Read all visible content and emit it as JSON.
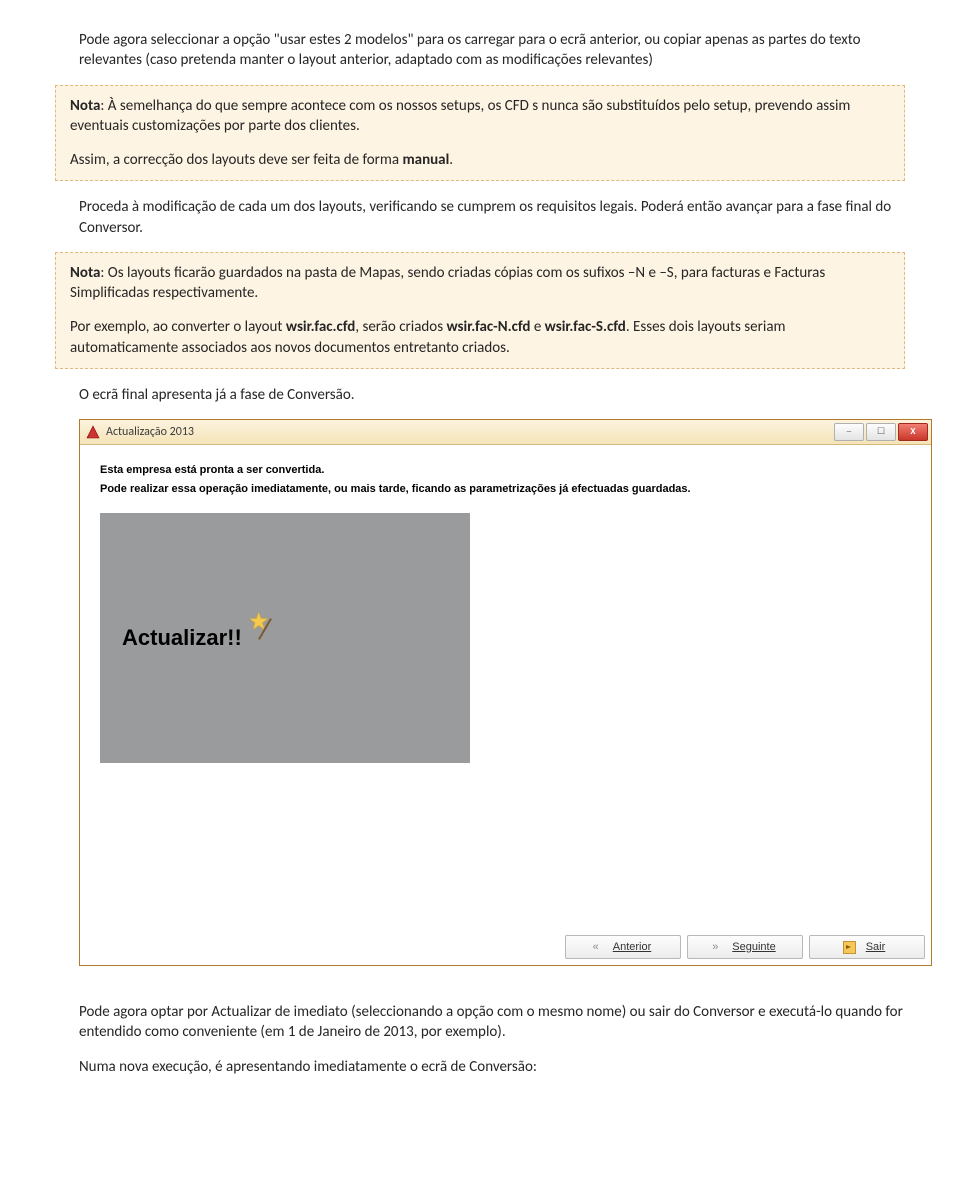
{
  "para1": "Pode agora seleccionar a opção \"usar estes 2 modelos\" para os carregar para o ecrã anterior, ou copiar apenas as partes do texto relevantes (caso pretenda manter o layout anterior, adaptado com as modificações relevantes)",
  "note1": {
    "nota_label": "Nota",
    "line1_rest": ": À semelhança do que sempre acontece com os nossos setups, os CFD s nunca são substituídos pelo setup, prevendo assim eventuais customizações por parte dos clientes.",
    "line2_pre": "Assim, a correcção dos layouts deve ser feita de forma ",
    "line2_bold": "manual",
    "line2_post": "."
  },
  "para2": "Proceda à modificação de cada um dos layouts, verificando se cumprem os requisitos legais. Poderá então avançar para a fase final do Conversor.",
  "note2": {
    "nota_label": "Nota",
    "line1_rest": ": Os layouts ficarão guardados na pasta de Mapas, sendo criadas cópias com os sufixos –N e –S, para facturas e Facturas Simplificadas respectivamente.",
    "line2_pre": "Por exemplo, ao converter o layout ",
    "f1": "wsir.fac.cfd",
    "line2_mid": ", serão criados ",
    "f2": "wsir.fac-N.cfd",
    "line2_and": " e ",
    "f3": "wsir.fac-S.cfd",
    "line2_post": ". Esses dois layouts seriam automaticamente associados aos novos documentos entretanto criados."
  },
  "para3": "O ecrã final apresenta já a fase de Conversão.",
  "dialog": {
    "title": "Actualização 2013",
    "msg1": "Esta empresa está pronta a ser convertida.",
    "msg2": "Pode realizar essa operação imediatamente, ou mais tarde, ficando as parametrizações já efectuadas guardadas.",
    "big_label": "Actualizar!!",
    "btn_prev": "Anterior",
    "btn_next": "Seguinte",
    "btn_exit": "Sair"
  },
  "para4": "Pode agora optar por Actualizar de imediato (seleccionando a opção com o mesmo nome) ou sair do Conversor e executá-lo quando for entendido como conveniente (em 1 de Janeiro de 2013, por exemplo).",
  "para5": "Numa nova execução, é apresentando imediatamente o ecrã de Conversão:"
}
